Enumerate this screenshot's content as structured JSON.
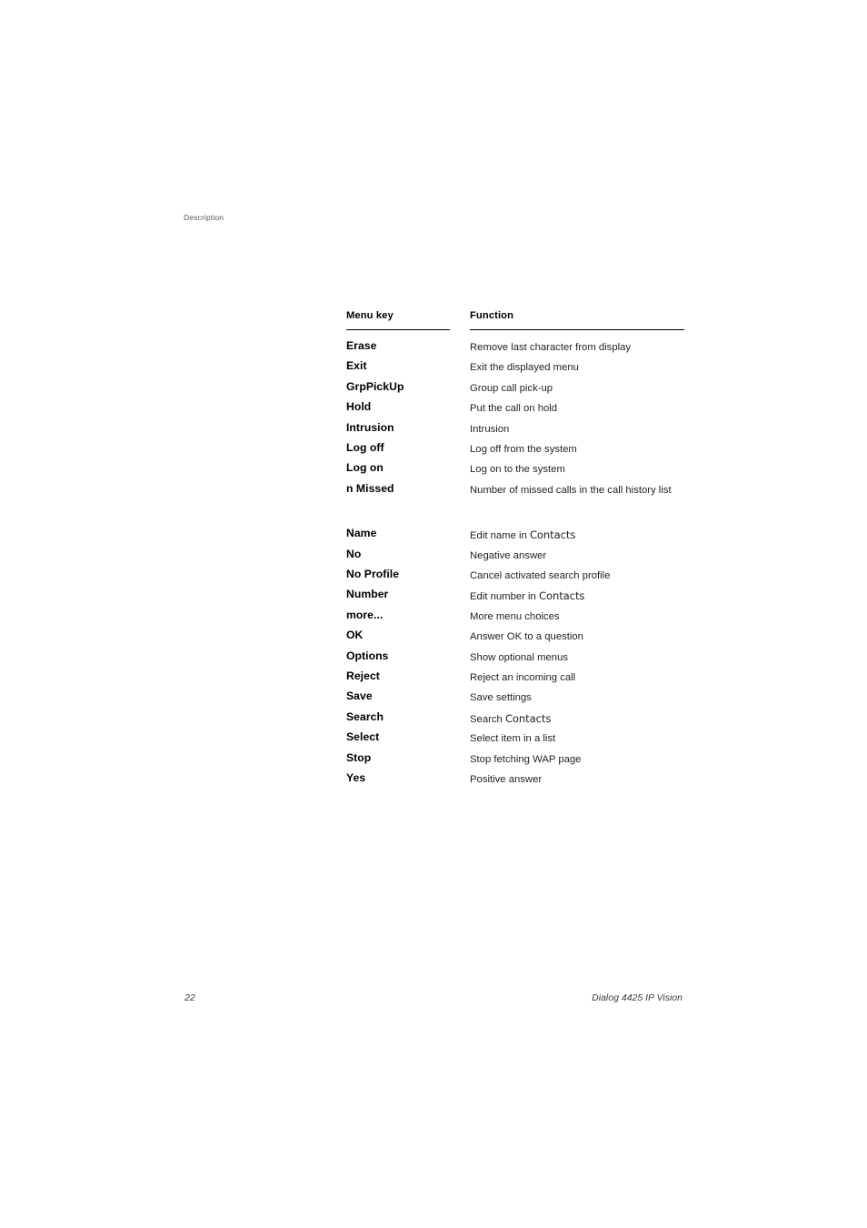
{
  "document": {
    "running_head": "Description",
    "footer": {
      "page_number": "22",
      "document_title": "Dialog 4425 IP Vision"
    }
  },
  "table": {
    "headers": {
      "menu_key": "Menu key",
      "function": "Function"
    },
    "rows": [
      {
        "key": "Erase",
        "function": "Remove last character from display",
        "ui_term": ""
      },
      {
        "key": "Exit",
        "function": "Exit the displayed menu",
        "ui_term": ""
      },
      {
        "key": "GrpPickUp",
        "function": "Group call pick-up",
        "ui_term": ""
      },
      {
        "key": "Hold",
        "function": "Put the call on hold",
        "ui_term": ""
      },
      {
        "key": "Intrusion",
        "function": "Intrusion",
        "ui_term": ""
      },
      {
        "key": "Log off",
        "function": "Log off from the system",
        "ui_term": ""
      },
      {
        "key": "Log on",
        "function": "Log on to the system",
        "ui_term": ""
      },
      {
        "key": "n Missed",
        "function": "Number of missed calls in the call history list",
        "ui_term": ""
      },
      {
        "key": "Name",
        "function": "Edit name in ",
        "ui_term": "Contacts"
      },
      {
        "key": "No",
        "function": "Negative answer",
        "ui_term": ""
      },
      {
        "key": "No Profile",
        "function": "Cancel activated search profile",
        "ui_term": ""
      },
      {
        "key": "Number",
        "function": "Edit number in ",
        "ui_term": "Contacts"
      },
      {
        "key": "more...",
        "function": "More menu choices",
        "ui_term": ""
      },
      {
        "key": "OK",
        "function": "Answer OK to a question",
        "ui_term": ""
      },
      {
        "key": "Options",
        "function": "Show optional menus",
        "ui_term": ""
      },
      {
        "key": "Reject",
        "function": "Reject an incoming call",
        "ui_term": ""
      },
      {
        "key": "Save",
        "function": "Save settings",
        "ui_term": ""
      },
      {
        "key": "Search",
        "function": "Search ",
        "ui_term": "Contacts"
      },
      {
        "key": "Select",
        "function": "Select item in a list",
        "ui_term": ""
      },
      {
        "key": "Stop",
        "function": "Stop fetching WAP page",
        "ui_term": ""
      },
      {
        "key": "Yes",
        "function": "Positive answer",
        "ui_term": ""
      }
    ]
  }
}
